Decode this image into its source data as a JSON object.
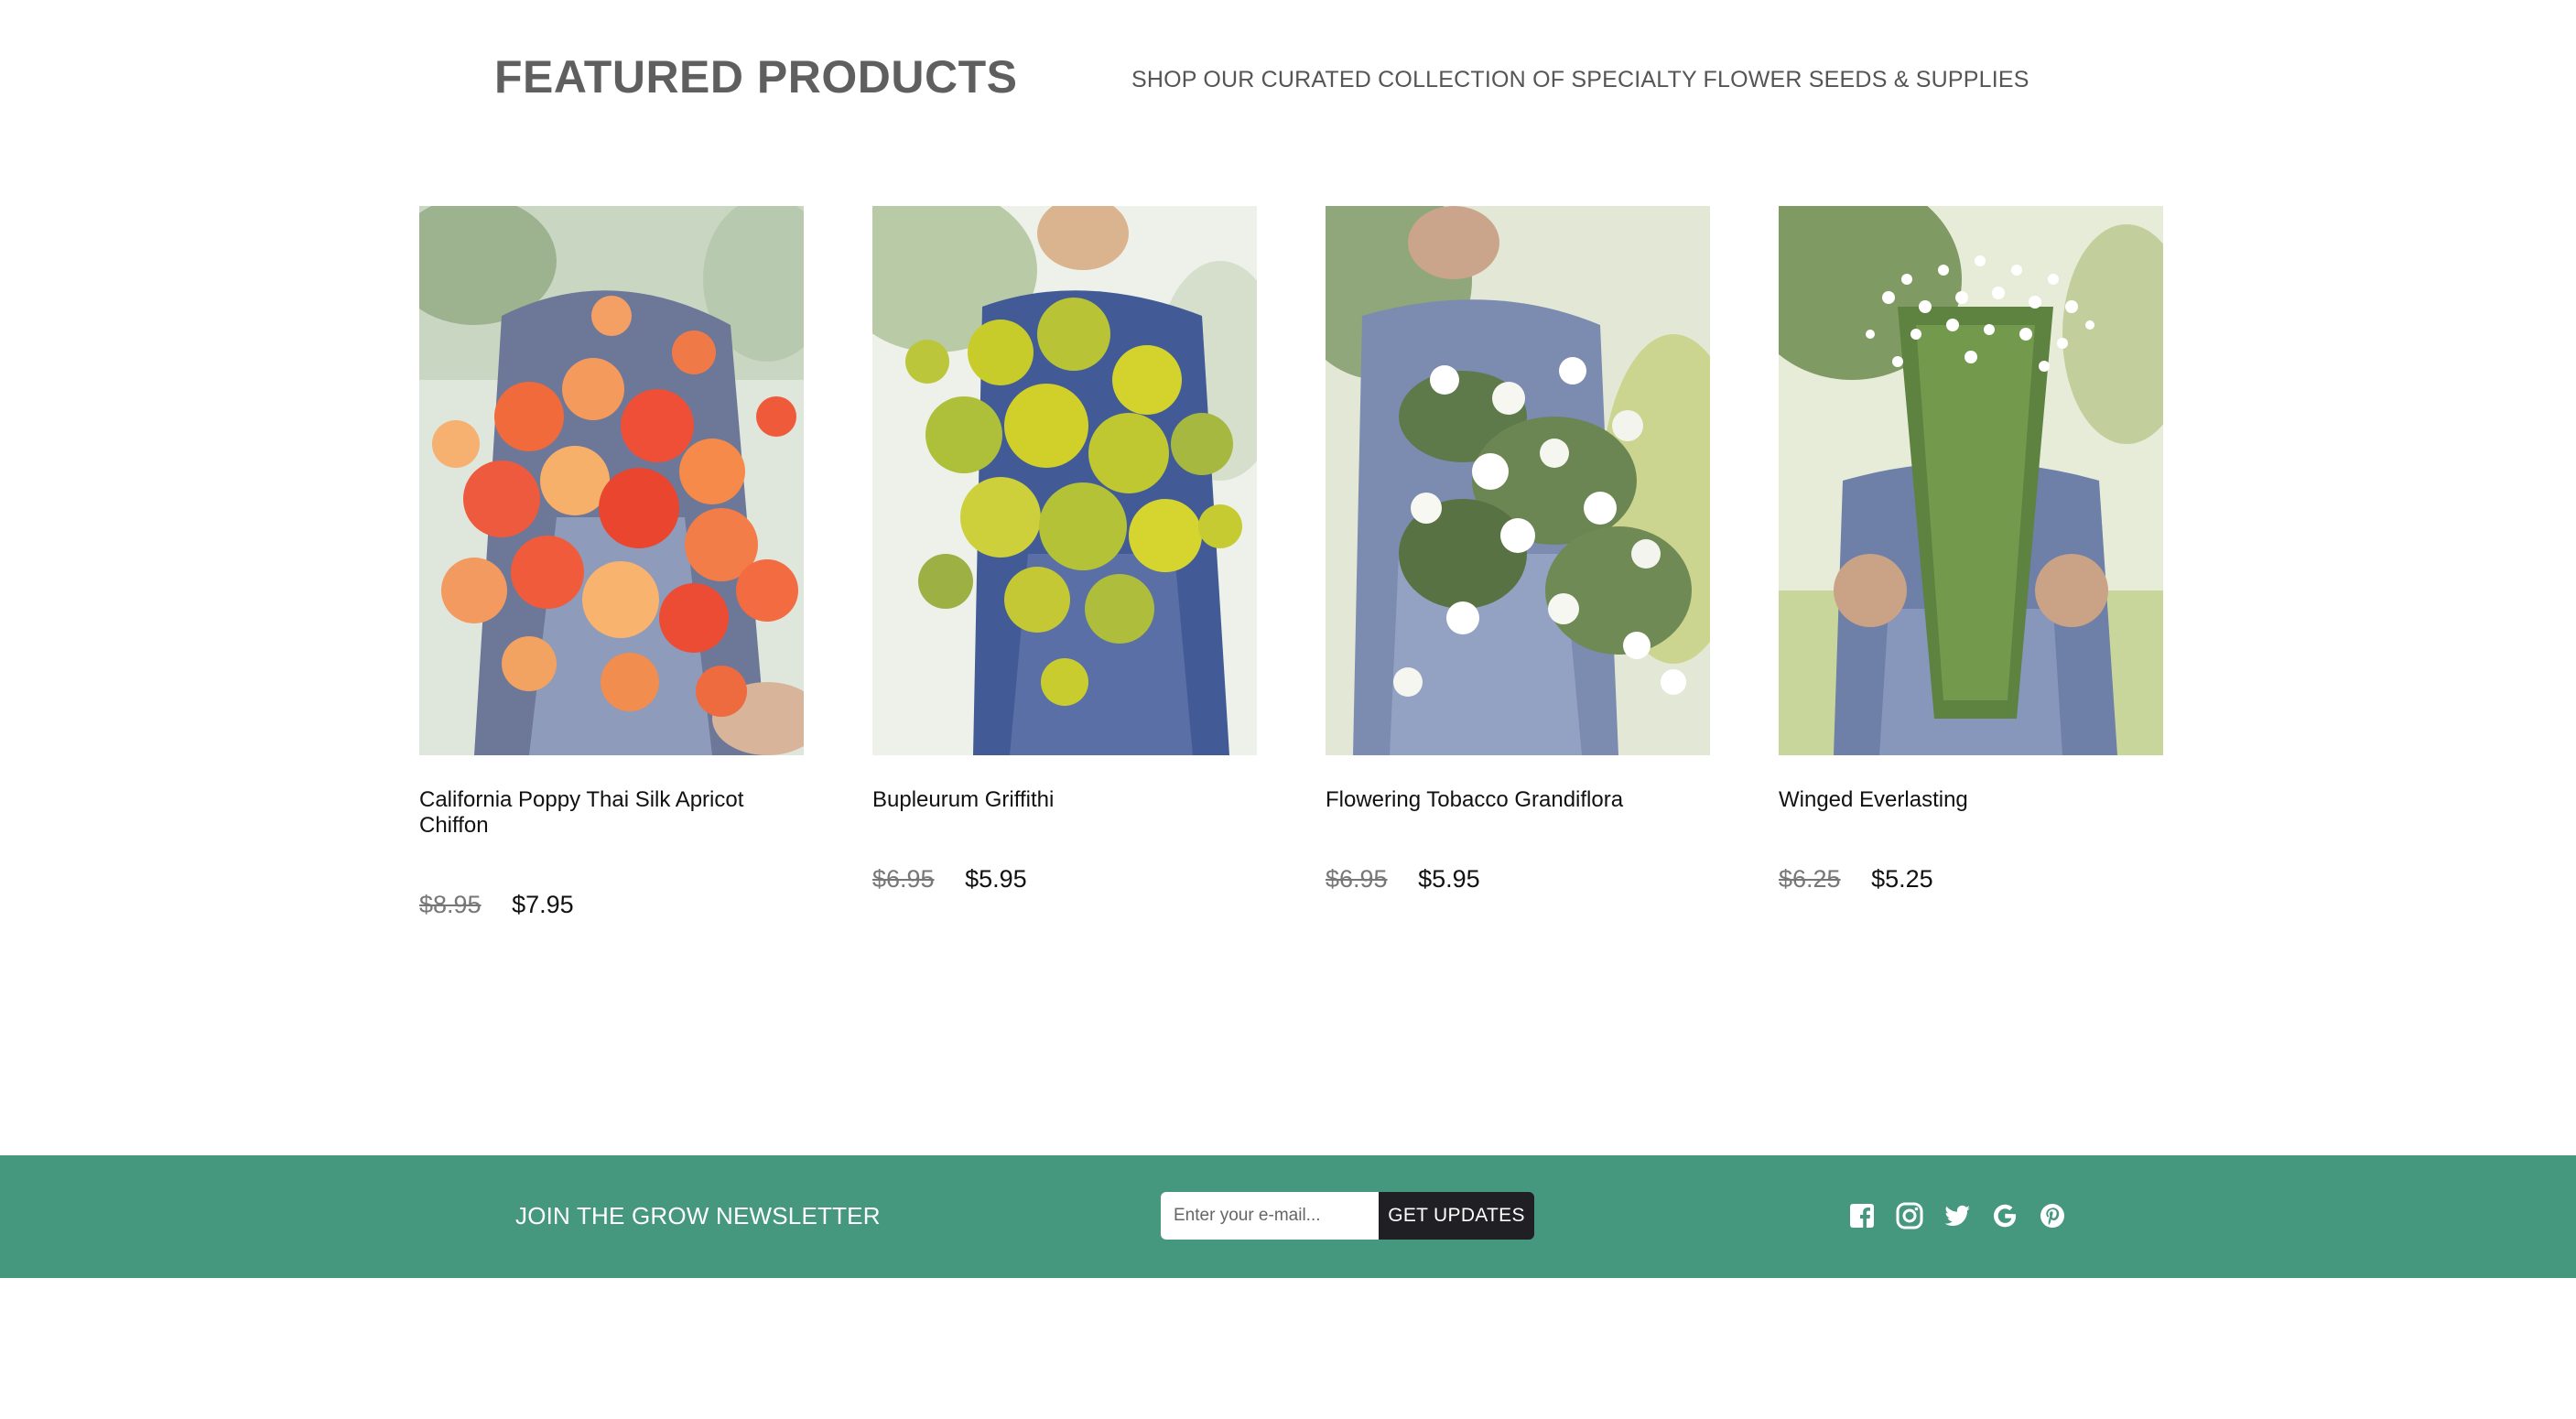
{
  "header": {
    "title": "FEATURED PRODUCTS",
    "subtitle": "SHOP OUR CURATED COLLECTION OF SPECIALTY FLOWER SEEDS & SUPPLIES"
  },
  "products": [
    {
      "name": "California Poppy Thai Silk Apricot Chiffon",
      "old_price": "$8.95",
      "price": "$7.95",
      "image": "orange-poppy-bouquet"
    },
    {
      "name": "Bupleurum Griffithi",
      "old_price": "$6.95",
      "price": "$5.95",
      "image": "yellow-green-bupleurum-bouquet"
    },
    {
      "name": "Flowering Tobacco Grandiflora",
      "old_price": "$6.95",
      "price": "$5.95",
      "image": "white-tobacco-flower-bouquet"
    },
    {
      "name": "Winged Everlasting",
      "old_price": "$6.25",
      "price": "$5.25",
      "image": "white-everlasting-bouquet"
    }
  ],
  "footer": {
    "newsletter_label": "JOIN THE GROW NEWSLETTER",
    "email_placeholder": "Enter your e-mail...",
    "button_label": "GET UPDATES",
    "social": [
      "facebook-icon",
      "instagram-icon",
      "twitter-icon",
      "google-icon",
      "pinterest-icon"
    ]
  },
  "colors": {
    "footer_bg": "#45977d",
    "button_bg": "#1f1f24",
    "title_gray": "#5f5f5f"
  }
}
